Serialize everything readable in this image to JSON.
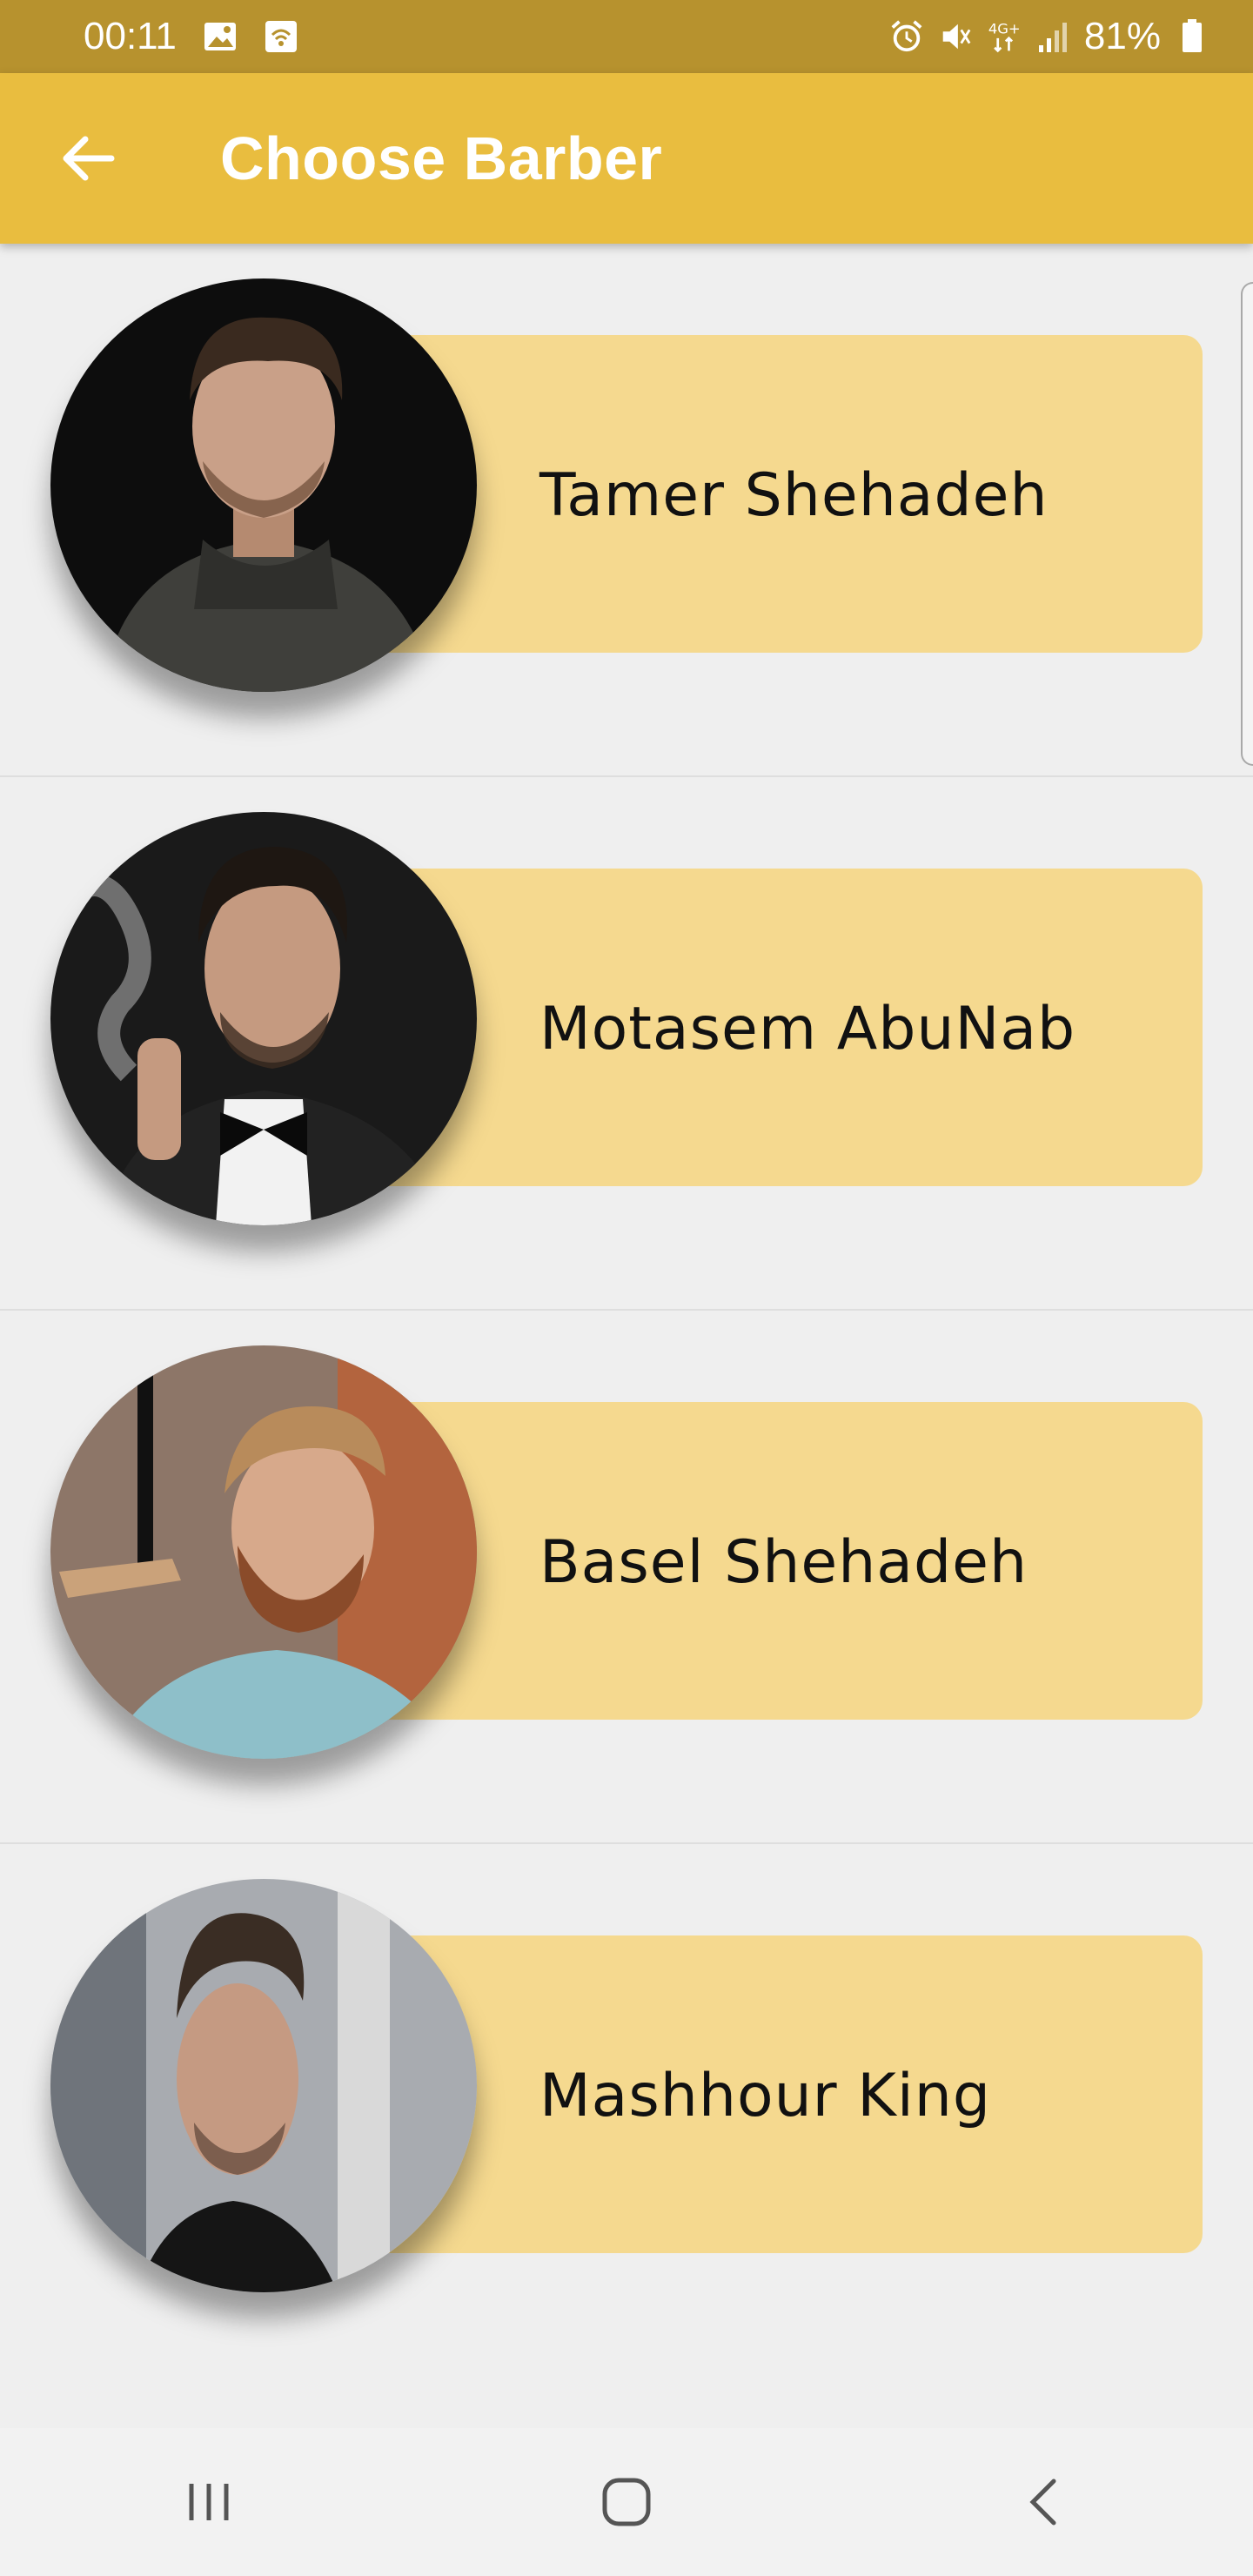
{
  "status_bar": {
    "time": "00:11",
    "battery_percent": "81%",
    "icons": [
      "image-icon",
      "wifi-calling-icon",
      "alarm-icon",
      "mute-icon",
      "network-4g-icon",
      "signal-icon",
      "battery-icon"
    ]
  },
  "app_bar": {
    "title": "Choose Barber",
    "back_icon": "arrow-left-icon"
  },
  "barbers": [
    {
      "name": "Tamer Shehadeh"
    },
    {
      "name": "Motasem AbuNab"
    },
    {
      "name": "Basel Shehadeh"
    },
    {
      "name": "Mashhour King"
    }
  ],
  "nav_bar": {
    "icons": [
      "recent-apps-icon",
      "home-icon",
      "back-icon"
    ]
  },
  "colors": {
    "status_bar": "#b7922e",
    "app_bar": "#e9bd3f",
    "card": "#f5d98f",
    "background": "#efefef"
  }
}
